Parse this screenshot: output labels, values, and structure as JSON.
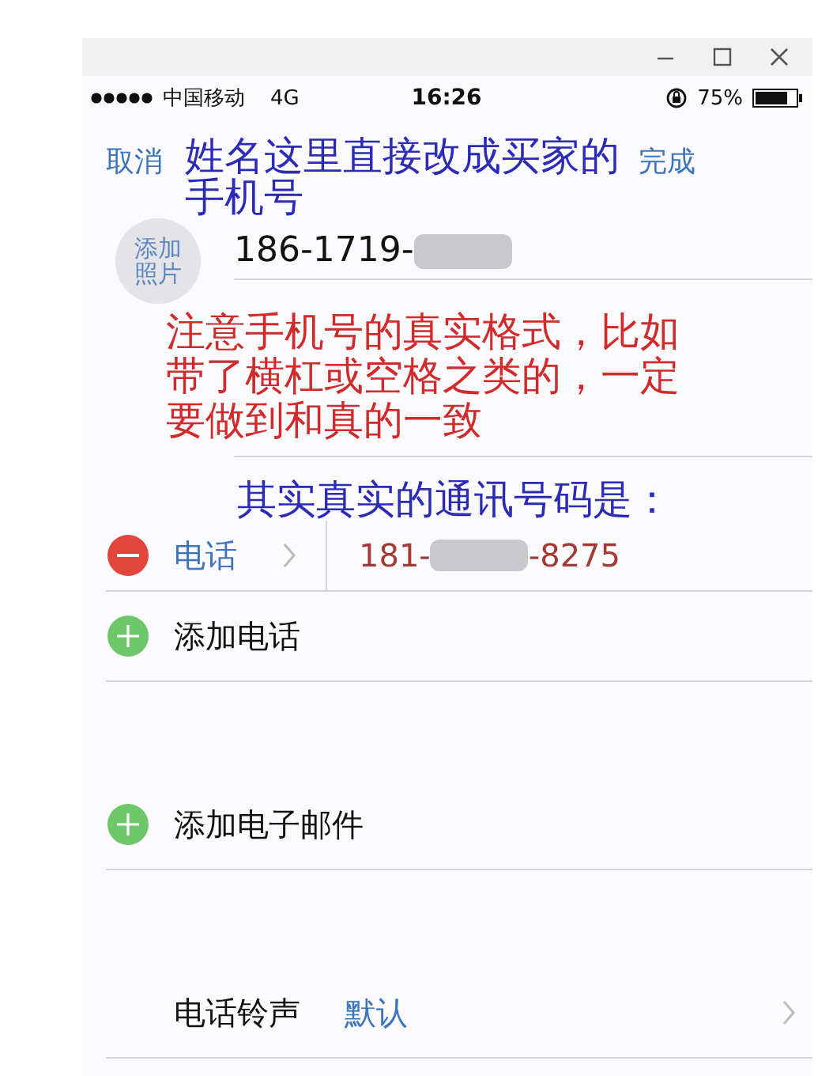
{
  "status_bar": {
    "carrier": "中国移动",
    "network": "4G",
    "time": "16:26",
    "battery": "75%"
  },
  "nav": {
    "cancel": "取消",
    "done": "完成"
  },
  "annotations": [
    {
      "text": "姓名这里直接改成买家的手机号",
      "color": "#2b2bb5"
    },
    {
      "text": "注意手机号的真实格式，比如带了横杠或空格之类的，一定要做到和真的一致",
      "color": "#d02a2a"
    },
    {
      "text": "其实真实的通讯号码是：",
      "color": "#2b2bb5"
    }
  ],
  "photo_button": "添加照片",
  "name_field": {
    "value": "186-1719-",
    "redacted": true
  },
  "sections": [
    [
      {
        "kind": "phone",
        "label": "电话",
        "number_start": "181-",
        "number_end": "-8275",
        "redacted": true
      },
      {
        "kind": "add",
        "label": "添加电话"
      }
    ],
    [
      {
        "kind": "add",
        "label": "添加电子邮件"
      }
    ],
    [
      {
        "kind": "setting",
        "label": "电话铃声",
        "value": "默认"
      }
    ]
  ]
}
